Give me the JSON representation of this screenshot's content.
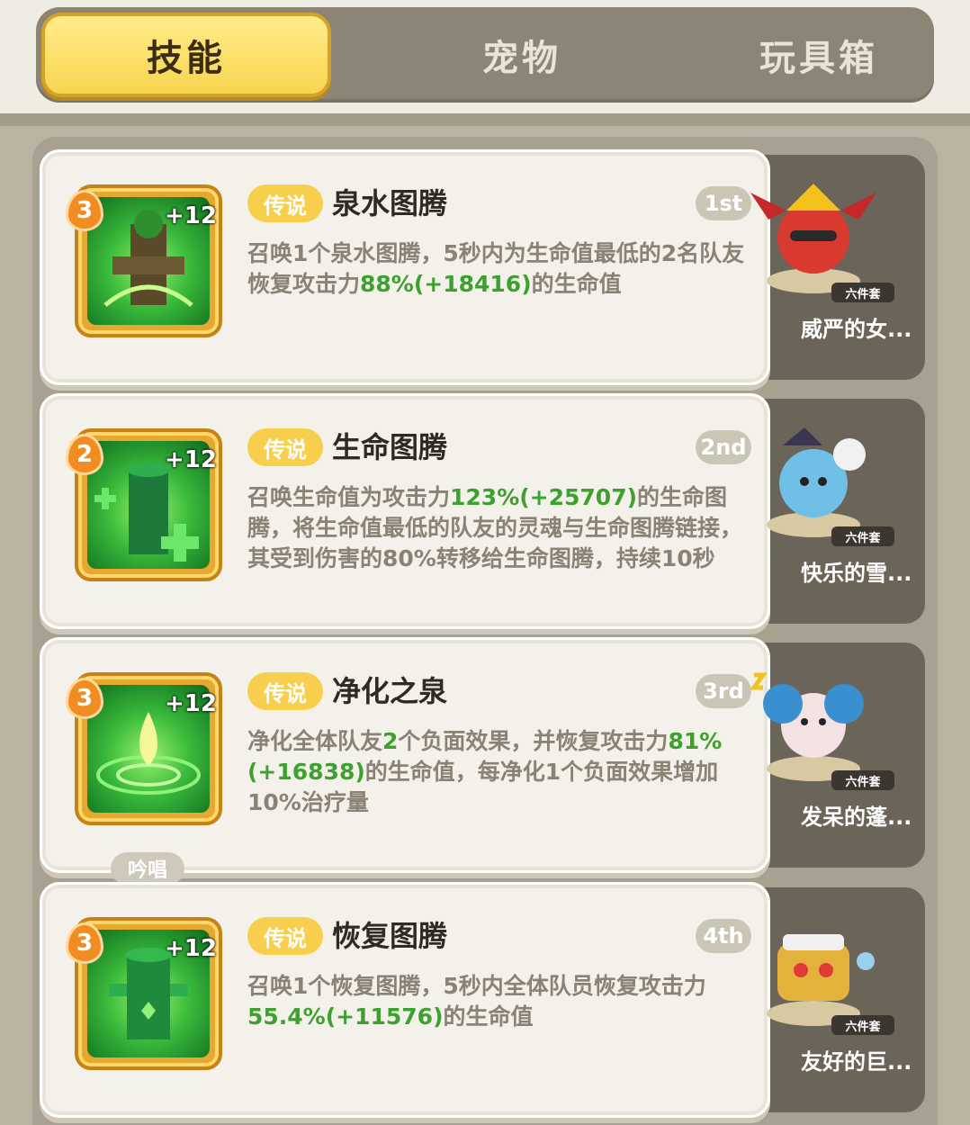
{
  "tabs": [
    {
      "label": "技能",
      "active": true
    },
    {
      "label": "宠物",
      "active": false
    },
    {
      "label": "玩具箱",
      "active": false
    }
  ],
  "skills": [
    {
      "level": "3",
      "plus": "+12",
      "rarity": "传说",
      "name": "泉水图腾",
      "rank": "1st",
      "desc": [
        {
          "t": "召唤1个泉水图腾，5秒内为生命值最低的2名队友恢复攻击力",
          "g": false
        },
        {
          "t": "88%(+18416)",
          "g": true
        },
        {
          "t": "的生命值",
          "g": false
        }
      ],
      "chant": "",
      "pet": {
        "set": "六件套",
        "name": "威严的女..."
      }
    },
    {
      "level": "2",
      "plus": "+12",
      "rarity": "传说",
      "name": "生命图腾",
      "rank": "2nd",
      "desc": [
        {
          "t": "召唤生命值为攻击力",
          "g": false
        },
        {
          "t": "123%(+25707)",
          "g": true
        },
        {
          "t": "的生命图腾，将生命值最低的队友的灵魂与生命图腾链接，其受到伤害的80%转移给生命图腾，持续10秒",
          "g": false
        }
      ],
      "chant": "",
      "pet": {
        "set": "六件套",
        "name": "快乐的雪..."
      }
    },
    {
      "level": "3",
      "plus": "+12",
      "rarity": "传说",
      "name": "净化之泉",
      "rank": "3rd",
      "desc": [
        {
          "t": "净化全体队友",
          "g": false
        },
        {
          "t": "2",
          "g": true
        },
        {
          "t": "个负面效果，并恢复攻击力",
          "g": false
        },
        {
          "t": "81%(+16838)",
          "g": true
        },
        {
          "t": "的生命值，每净化1个负面效果增加10%治疗量",
          "g": false
        }
      ],
      "chant": "吟唱",
      "pet": {
        "set": "六件套",
        "name": "发呆的蓬..."
      }
    },
    {
      "level": "3",
      "plus": "+12",
      "rarity": "传说",
      "name": "恢复图腾",
      "rank": "4th",
      "desc": [
        {
          "t": "召唤1个恢复图腾，5秒内全体队员恢复攻击力",
          "g": false
        },
        {
          "t": "55.4%(+11576)",
          "g": true
        },
        {
          "t": "的生命值",
          "g": false
        }
      ],
      "chant": "",
      "pet": {
        "set": "六件套",
        "name": "友好的巨..."
      }
    }
  ],
  "colors": {
    "active_tab": "#f8d54f",
    "rarity_badge": "#f7cf4c",
    "highlight_text": "#3da12f",
    "pet_panel": "#6b6458"
  },
  "icons": [
    "spring-totem-icon",
    "life-totem-icon",
    "purify-spring-icon",
    "recovery-totem-icon"
  ]
}
